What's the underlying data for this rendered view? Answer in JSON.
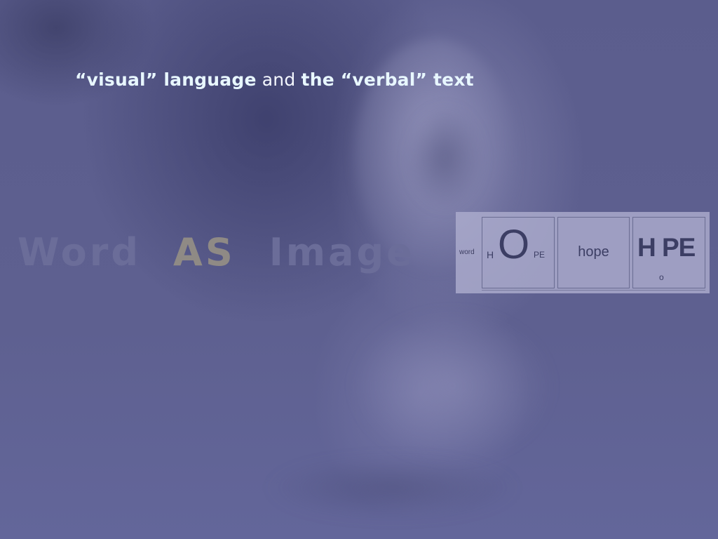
{
  "slide": {
    "title": {
      "part1": "“visual” language",
      "part2": " and ",
      "part3": "the “verbal” text"
    },
    "background_heading": {
      "word": "Word",
      "as": "AS",
      "image": "Image"
    },
    "panel": {
      "label": "word",
      "cells": [
        {
          "h": "H",
          "o": "O",
          "pe": "PE"
        },
        {
          "text": "hope"
        },
        {
          "big": "H PE",
          "small": "o"
        }
      ]
    }
  }
}
